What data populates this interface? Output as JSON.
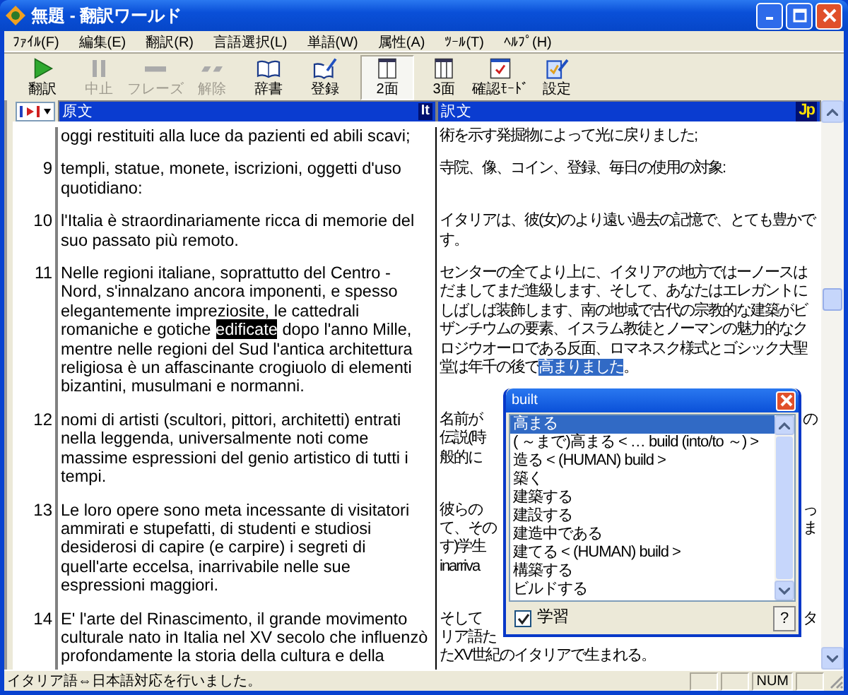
{
  "window": {
    "title": "無題 - 翻訳ワールド"
  },
  "menu": [
    "ﾌｧｲﾙ(F)",
    "編集(E)",
    "翻訳(R)",
    "言語選択(L)",
    "単語(W)",
    "属性(A)",
    "ﾂｰﾙ(T)",
    "ﾍﾙﾌﾟ(H)"
  ],
  "toolbar": [
    {
      "label": "翻訳",
      "kind": "play",
      "disabled": false,
      "selected": false
    },
    {
      "label": "中止",
      "kind": "pause",
      "disabled": true,
      "selected": false
    },
    {
      "label": "フレーズ",
      "kind": "phrase",
      "disabled": true,
      "selected": false
    },
    {
      "label": "解除",
      "kind": "release",
      "disabled": true,
      "selected": false
    },
    {
      "label": "辞書",
      "kind": "book",
      "disabled": false,
      "selected": false
    },
    {
      "label": "登録",
      "kind": "register",
      "disabled": false,
      "selected": false
    },
    {
      "label": "2面",
      "kind": "two",
      "disabled": false,
      "selected": true
    },
    {
      "label": "3面",
      "kind": "three",
      "disabled": false,
      "selected": false
    },
    {
      "label": "確認ﾓｰﾄﾞ",
      "kind": "confirm",
      "disabled": false,
      "selected": false
    },
    {
      "label": "設定",
      "kind": "settings",
      "disabled": false,
      "selected": false
    }
  ],
  "source_header": {
    "label": "原文",
    "badge": "It"
  },
  "target_header": {
    "label": "訳文",
    "badge": "Jp"
  },
  "rows": [
    {
      "number": "",
      "source": [
        {
          "text": "oggi restituiti alla luce da pazienti ed abili scavi;",
          "highlighted": false
        }
      ],
      "target": [
        {
          "text": "術を示す発掘物によって光に戻りました;",
          "highlighted": false
        }
      ]
    },
    {
      "number": "9",
      "source": [
        {
          "text": "templi, statue, monete, iscrizioni, oggetti d'uso quotidiano:",
          "highlighted": false
        }
      ],
      "target": [
        {
          "text": "寺院、像、コイン、登録、毎日の使用の対象:",
          "highlighted": false
        }
      ]
    },
    {
      "number": "10",
      "source": [
        {
          "text": "l'Italia è straordinariamente ricca di memorie del suo passato più remoto.",
          "highlighted": false
        }
      ],
      "target": [
        {
          "text": "イタリアは、彼(女)のより遠い過去の記憶で、とても豊かです。",
          "highlighted": false
        }
      ]
    },
    {
      "number": "11",
      "source": [
        {
          "text": "Nelle regioni italiane, soprattutto del Centro - Nord, s'innalzano ancora imponenti, e spesso elegantemente impreziosite, le cattedrali romaniche e gotiche ",
          "highlighted": false
        },
        {
          "text": "edificate",
          "highlighted": true
        },
        {
          "text": " dopo l'anno Mille, mentre nelle regioni del Sud l'antica architettura religiosa è un affascinante crogiuolo di elementi bizantini, musulmani e normanni.",
          "highlighted": false
        }
      ],
      "target": [
        {
          "text": "センターの全てより上に、イタリアの地方ではーノースはだましてまだ進級します、そして、あなたはエレガントにしばしば装飾します、南の地域で古代の宗教的な建築がビザンチウムの要素、イスラム教徒とノーマンの魅力的なクロジウオーロである反面、ロマネスク様式とゴシック大聖堂は年千の後で",
          "highlighted": false
        },
        {
          "text": "高まりました",
          "highlighted": true
        },
        {
          "text": "。",
          "highlighted": false
        }
      ]
    },
    {
      "number": "12",
      "source": [
        {
          "text": "nomi di artisti (scultori, pittori, architetti) entrati nella leggenda, universalmente noti come massime espressioni del genio artistico di tutti i tempi.",
          "highlighted": false
        }
      ],
      "target_lines": [
        {
          "left": "名前が",
          "right": "の"
        },
        {
          "left": "伝説(時"
        },
        {
          "left": "般的に"
        }
      ]
    },
    {
      "number": "13",
      "source": [
        {
          "text": "Le loro opere sono meta incessante di visitatori ammirati e stupefatti, di studenti e studiosi desiderosi di capire (e carpire) i segreti di quell'arte eccelsa, inarrivabile nelle sue espressioni maggiori.",
          "highlighted": false
        }
      ],
      "target_lines": [
        {
          "left": "彼らの",
          "right": "っ"
        },
        {
          "left": "て、その",
          "right": "ま"
        },
        {
          "left": "す)学生"
        },
        {
          "left": "inarriva"
        }
      ]
    },
    {
      "number": "14",
      "source": [
        {
          "text": "E' l'arte del Rinascimento, il grande movimento culturale nato in Italia nel XV secolo che influenzò profondamente la storia della cultura e della",
          "highlighted": false
        }
      ],
      "target_lines": [
        {
          "left": "そして",
          "right": "タ"
        },
        {
          "left": "リア語た"
        },
        {
          "left": "たXV世紀のイタリアで生まれる。"
        }
      ]
    }
  ],
  "popup": {
    "title": "built",
    "items": [
      {
        "label": "高まる",
        "selected": true
      },
      {
        "label": "( ～まで)高まる < … build (into/to ～) >",
        "selected": false
      },
      {
        "label": "造る < (HUMAN) build >",
        "selected": false
      },
      {
        "label": "築く",
        "selected": false
      },
      {
        "label": "建築する",
        "selected": false
      },
      {
        "label": "建設する",
        "selected": false
      },
      {
        "label": "建造中である",
        "selected": false
      },
      {
        "label": "建てる < (HUMAN) build >",
        "selected": false
      },
      {
        "label": "構築する",
        "selected": false
      },
      {
        "label": "ビルドする",
        "selected": false
      }
    ],
    "learn": {
      "label": "学習",
      "checked": true
    },
    "help": "?"
  },
  "status_bar": {
    "message": "イタリア語⇔日本語対応を行いました。",
    "indicators": [
      {
        "label": "NUM"
      }
    ]
  }
}
